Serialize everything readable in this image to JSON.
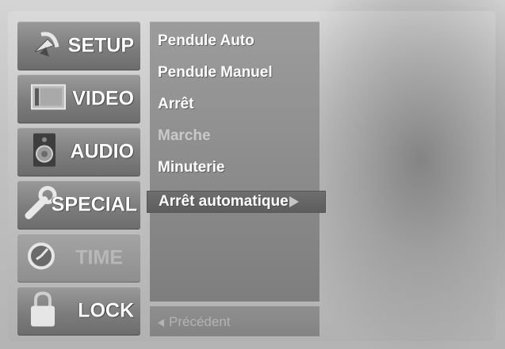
{
  "sidebar": {
    "items": [
      {
        "label": "SETUP",
        "icon": "satellite-dish-icon"
      },
      {
        "label": "VIDEO",
        "icon": "screen-icon"
      },
      {
        "label": "AUDIO",
        "icon": "speaker-icon"
      },
      {
        "label": "SPECIAL",
        "icon": "wrench-icon"
      },
      {
        "label": "TIME",
        "icon": "clock-icon",
        "active": true
      },
      {
        "label": "LOCK",
        "icon": "padlock-icon"
      }
    ]
  },
  "submenu": {
    "items": [
      {
        "label": "Pendule Auto"
      },
      {
        "label": "Pendule Manuel"
      },
      {
        "label": "Arrêt"
      },
      {
        "label": "Marche"
      },
      {
        "label": "Minuterie"
      },
      {
        "label": "Arrêt automatique",
        "selected": true
      }
    ],
    "back_label": "Précédent"
  },
  "colors": {
    "panel": "#8a8a8a",
    "text": "#ffffff",
    "disabled_text": "#c9c9c9"
  }
}
